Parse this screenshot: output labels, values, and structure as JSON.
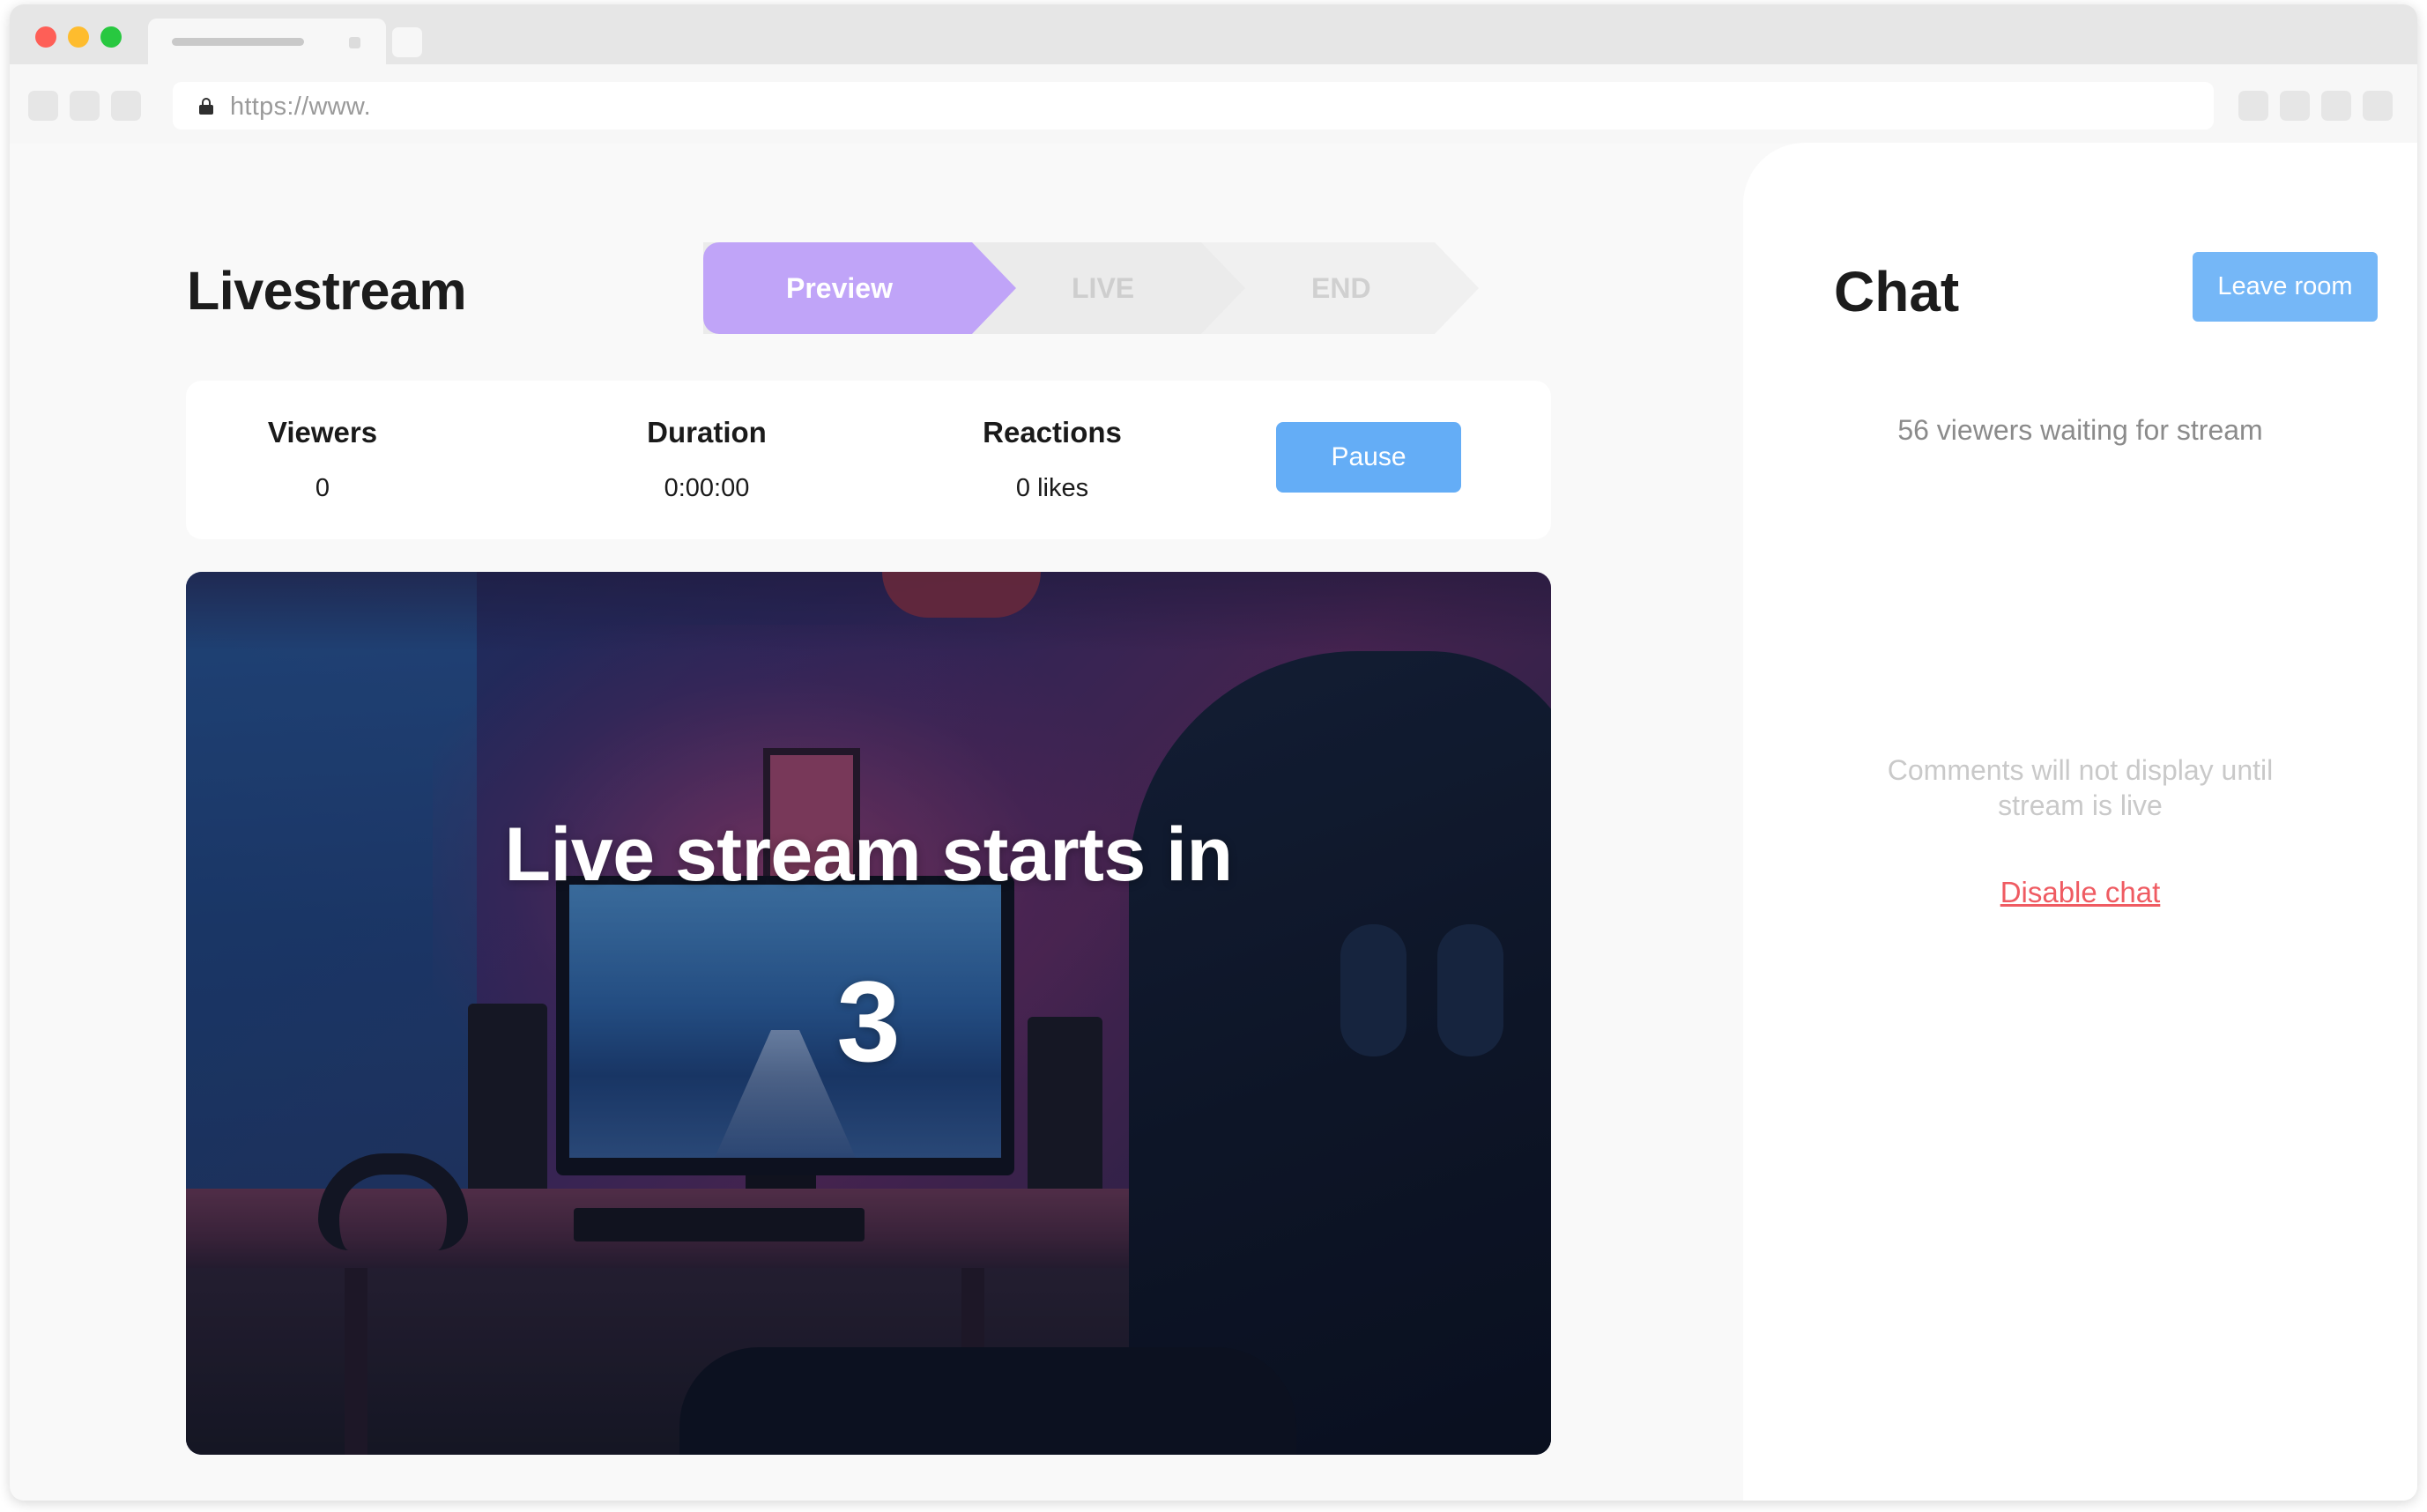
{
  "browser": {
    "url": "https://www."
  },
  "livestream": {
    "title": "Livestream",
    "steps": [
      {
        "label": "Preview",
        "state": "active"
      },
      {
        "label": "LIVE",
        "state": "inactive"
      },
      {
        "label": "END",
        "state": "inactive"
      }
    ],
    "stats": {
      "viewers": {
        "label": "Viewers",
        "value": "0"
      },
      "duration": {
        "label": "Duration",
        "value": "0:00:00"
      },
      "reactions": {
        "label": "Reactions",
        "value": "0 likes"
      }
    },
    "pause_label": "Pause",
    "countdown": {
      "title": "Live stream starts in",
      "number": "3"
    }
  },
  "chat": {
    "title": "Chat",
    "leave_label": "Leave room",
    "waiting_text": "56 viewers waiting for stream",
    "notice_text": "Comments will not display until stream is live",
    "disable_label": "Disable chat"
  },
  "colors": {
    "preview_step": "#c0a4f8",
    "primary_button": "#64adf6",
    "leave_button": "#75b7f7",
    "disable_link": "#ef5b62"
  }
}
